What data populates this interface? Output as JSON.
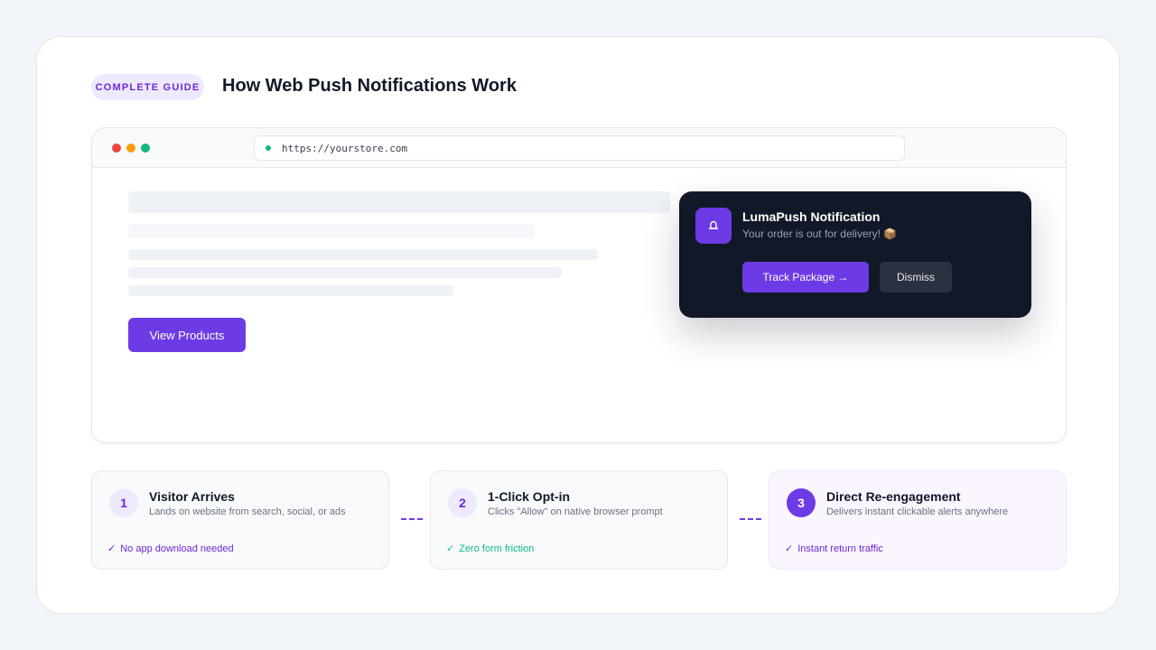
{
  "header": {
    "badge": "COMPLETE GUIDE",
    "title": "How Web Push Notifications Work"
  },
  "browser": {
    "url": "https://yourstore.com",
    "view_button": "View Products"
  },
  "notification": {
    "icon": "bell-icon",
    "title": "LumaPush Notification",
    "body": "Your order is out for delivery! 📦",
    "primary_button": "Track Package →",
    "secondary_button": "Dismiss"
  },
  "steps": [
    {
      "number": "1",
      "title": "Visitor Arrives",
      "description": "Lands on website from search, social, or ads",
      "check": "No app download needed",
      "check_color": "#6d28d9"
    },
    {
      "number": "2",
      "title": "1-Click Opt-in",
      "description": "Clicks \"Allow\" on native browser prompt",
      "check": "Zero form friction",
      "check_color": "#10b981"
    },
    {
      "number": "3",
      "title": "Direct Re-engagement",
      "description": "Delivers instant clickable alerts anywhere",
      "check": "Instant return traffic",
      "check_color": "#6d28d9"
    }
  ],
  "check_mark": "✓",
  "colors": {
    "accent": "#6d3be6",
    "notification_bg": "#111827",
    "success": "#10b981"
  }
}
